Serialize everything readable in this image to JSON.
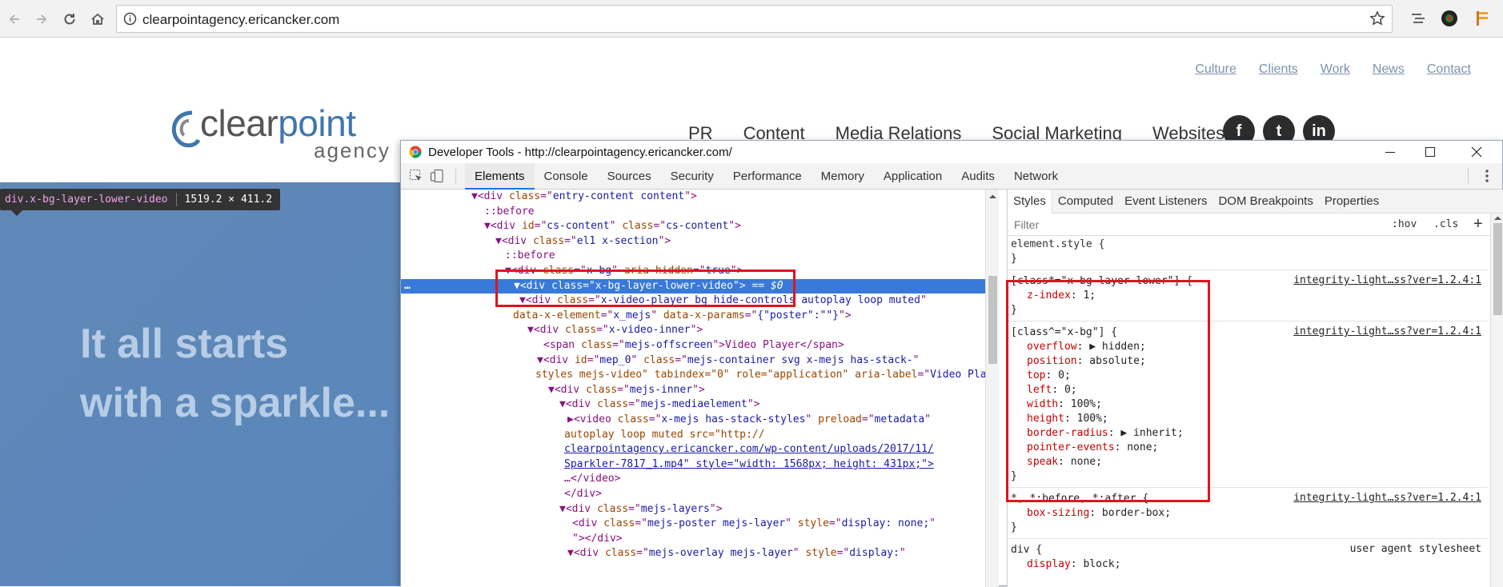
{
  "browser": {
    "url": "clearpointagency.ericancker.com"
  },
  "site": {
    "topnav": [
      "Culture",
      "Clients",
      "Work",
      "News",
      "Contact"
    ],
    "logo_word_a": "clear",
    "logo_word_b": "point",
    "logo_sub": "agency",
    "mainnav": [
      "PR",
      "Content",
      "Media Relations",
      "Social Marketing",
      "Websites"
    ],
    "social": [
      "f",
      "t",
      "in"
    ],
    "hero_line1": "It all starts",
    "hero_line2": "with a sparkle..."
  },
  "tooltip": {
    "selector": "div.x-bg-layer-lower-video",
    "size": "1519.2 × 411.2"
  },
  "devtools": {
    "title": "Developer Tools - http://clearpointagency.ericancker.com/",
    "tabs": [
      "Elements",
      "Console",
      "Sources",
      "Security",
      "Performance",
      "Memory",
      "Application",
      "Audits",
      "Network"
    ],
    "active_tab": "Elements",
    "dom_lines": [
      {
        "pre": "▼<",
        "t": "div",
        "a": [
          [
            "class",
            "entry-content content"
          ]
        ],
        "post": ">"
      },
      {
        "raw": "::before"
      },
      {
        "pre": "▼<",
        "t": "div",
        "a": [
          [
            "id",
            "cs-content"
          ],
          [
            "class",
            "cs-content"
          ]
        ],
        "post": ">"
      },
      {
        "pre": "▼<",
        "t": "div",
        "a": [
          [
            "class",
            "el1 x-section"
          ]
        ],
        "post": ">"
      },
      {
        "raw": "::before"
      },
      {
        "pre": "▼<",
        "t": "div",
        "a": [
          [
            "class",
            "x-bg"
          ],
          [
            "aria-hidden",
            "true"
          ]
        ],
        "post": ">"
      },
      {
        "pre": "▼<",
        "t": "div",
        "a": [
          [
            "class",
            "x-bg-layer-lower-video"
          ]
        ],
        "post": "> == $0"
      },
      {
        "pre": "▼<",
        "t": "div",
        "a": [
          [
            "class",
            "x-video-player bg hide-controls autoplay loop muted"
          ]
        ],
        "post": ""
      },
      {
        "pre": "",
        "t": "",
        "a": [
          [
            "data-x-element",
            "x_mejs"
          ],
          [
            "data-x-params",
            "{\"poster\":\"\"}"
          ]
        ],
        "post": ">"
      },
      {
        "pre": "▼<",
        "t": "div",
        "a": [
          [
            "class",
            "x-video-inner"
          ]
        ],
        "post": ">"
      },
      {
        "pre": "<",
        "t": "span",
        "a": [
          [
            "class",
            "mejs-offscreen"
          ]
        ],
        "post": ">Video Player</span>"
      },
      {
        "pre": "▼<",
        "t": "div",
        "a": [
          [
            "id",
            "mep_0"
          ],
          [
            "class",
            "mejs-container svg x-mejs has-stack-"
          ]
        ],
        "post": ""
      },
      {
        "pre": "",
        "t": "",
        "a": [
          [
            "styles mejs-video\" tabindex=\"0\" role=\"application\" aria-label",
            "Video Player"
          ]
        ],
        "post": ">"
      },
      {
        "pre": "▼<",
        "t": "div",
        "a": [
          [
            "class",
            "mejs-inner"
          ]
        ],
        "post": ">"
      },
      {
        "pre": "▼<",
        "t": "div",
        "a": [
          [
            "class",
            "mejs-mediaelement"
          ]
        ],
        "post": ">"
      },
      {
        "pre": "▶<",
        "t": "video",
        "a": [
          [
            "class",
            "x-mejs has-stack-styles"
          ],
          [
            "preload",
            "metadata"
          ]
        ],
        "post": ""
      },
      {
        "raw": "autoplay loop muted src=\"http://"
      },
      {
        "raw": "clearpointagency.ericancker.com/wp-content/uploads/2017/11/"
      },
      {
        "raw": "Sparkler-7817_1.mp4\" style=\"width: 1568px; height: 431px;\">"
      },
      {
        "raw": "…</video>"
      },
      {
        "raw": "</div>"
      },
      {
        "pre": "▼<",
        "t": "div",
        "a": [
          [
            "class",
            "mejs-layers"
          ]
        ],
        "post": ">"
      },
      {
        "pre": "<",
        "t": "div",
        "a": [
          [
            "class",
            "mejs-poster mejs-layer"
          ],
          [
            "style",
            "display: none;"
          ]
        ],
        "post": ""
      },
      {
        "raw": "\"></div>"
      },
      {
        "pre": "▼<",
        "t": "div",
        "a": [
          [
            "class",
            "mejs-overlay mejs-layer"
          ],
          [
            "style",
            "display:"
          ]
        ],
        "post": ""
      }
    ],
    "style_tabs": [
      "Styles",
      "Computed",
      "Event Listeners",
      "DOM Breakpoints",
      "Properties"
    ],
    "filter_placeholder": "Filter",
    "hov": ":hov",
    "cls": ".cls",
    "plus": "+",
    "css": {
      "element_style": "element.style {",
      "close": "}",
      "rule1_sel": "[class*=\"x-bg-layer-lower\"] {",
      "rule1_src": "integrity-light…ss?ver=1.2.4:1",
      "rule1_props": [
        [
          "z-index",
          "1"
        ]
      ],
      "rule2_sel": "[class^=\"x-bg\"] {",
      "rule2_src": "integrity-light…ss?ver=1.2.4:1",
      "rule2_props": [
        [
          "overflow",
          "▶ hidden"
        ],
        [
          "position",
          "absolute"
        ],
        [
          "top",
          "0"
        ],
        [
          "left",
          "0"
        ],
        [
          "width",
          "100%"
        ],
        [
          "height",
          "100%"
        ],
        [
          "border-radius",
          "▶ inherit"
        ],
        [
          "pointer-events",
          "none"
        ],
        [
          "speak",
          "none"
        ]
      ],
      "rule3_sel": "*, *:before, *:after {",
      "rule3_src": "integrity-light…ss?ver=1.2.4:1",
      "rule3_props": [
        [
          "box-sizing",
          "border-box"
        ]
      ],
      "rule4_sel": "div {",
      "rule4_src": "user agent stylesheet",
      "rule4_props": [
        [
          "display",
          "block"
        ]
      ]
    }
  },
  "colors": {
    "accent_red": "#e0141f",
    "selection_blue": "#3879d9",
    "hero_blue": "#5a86bb"
  }
}
